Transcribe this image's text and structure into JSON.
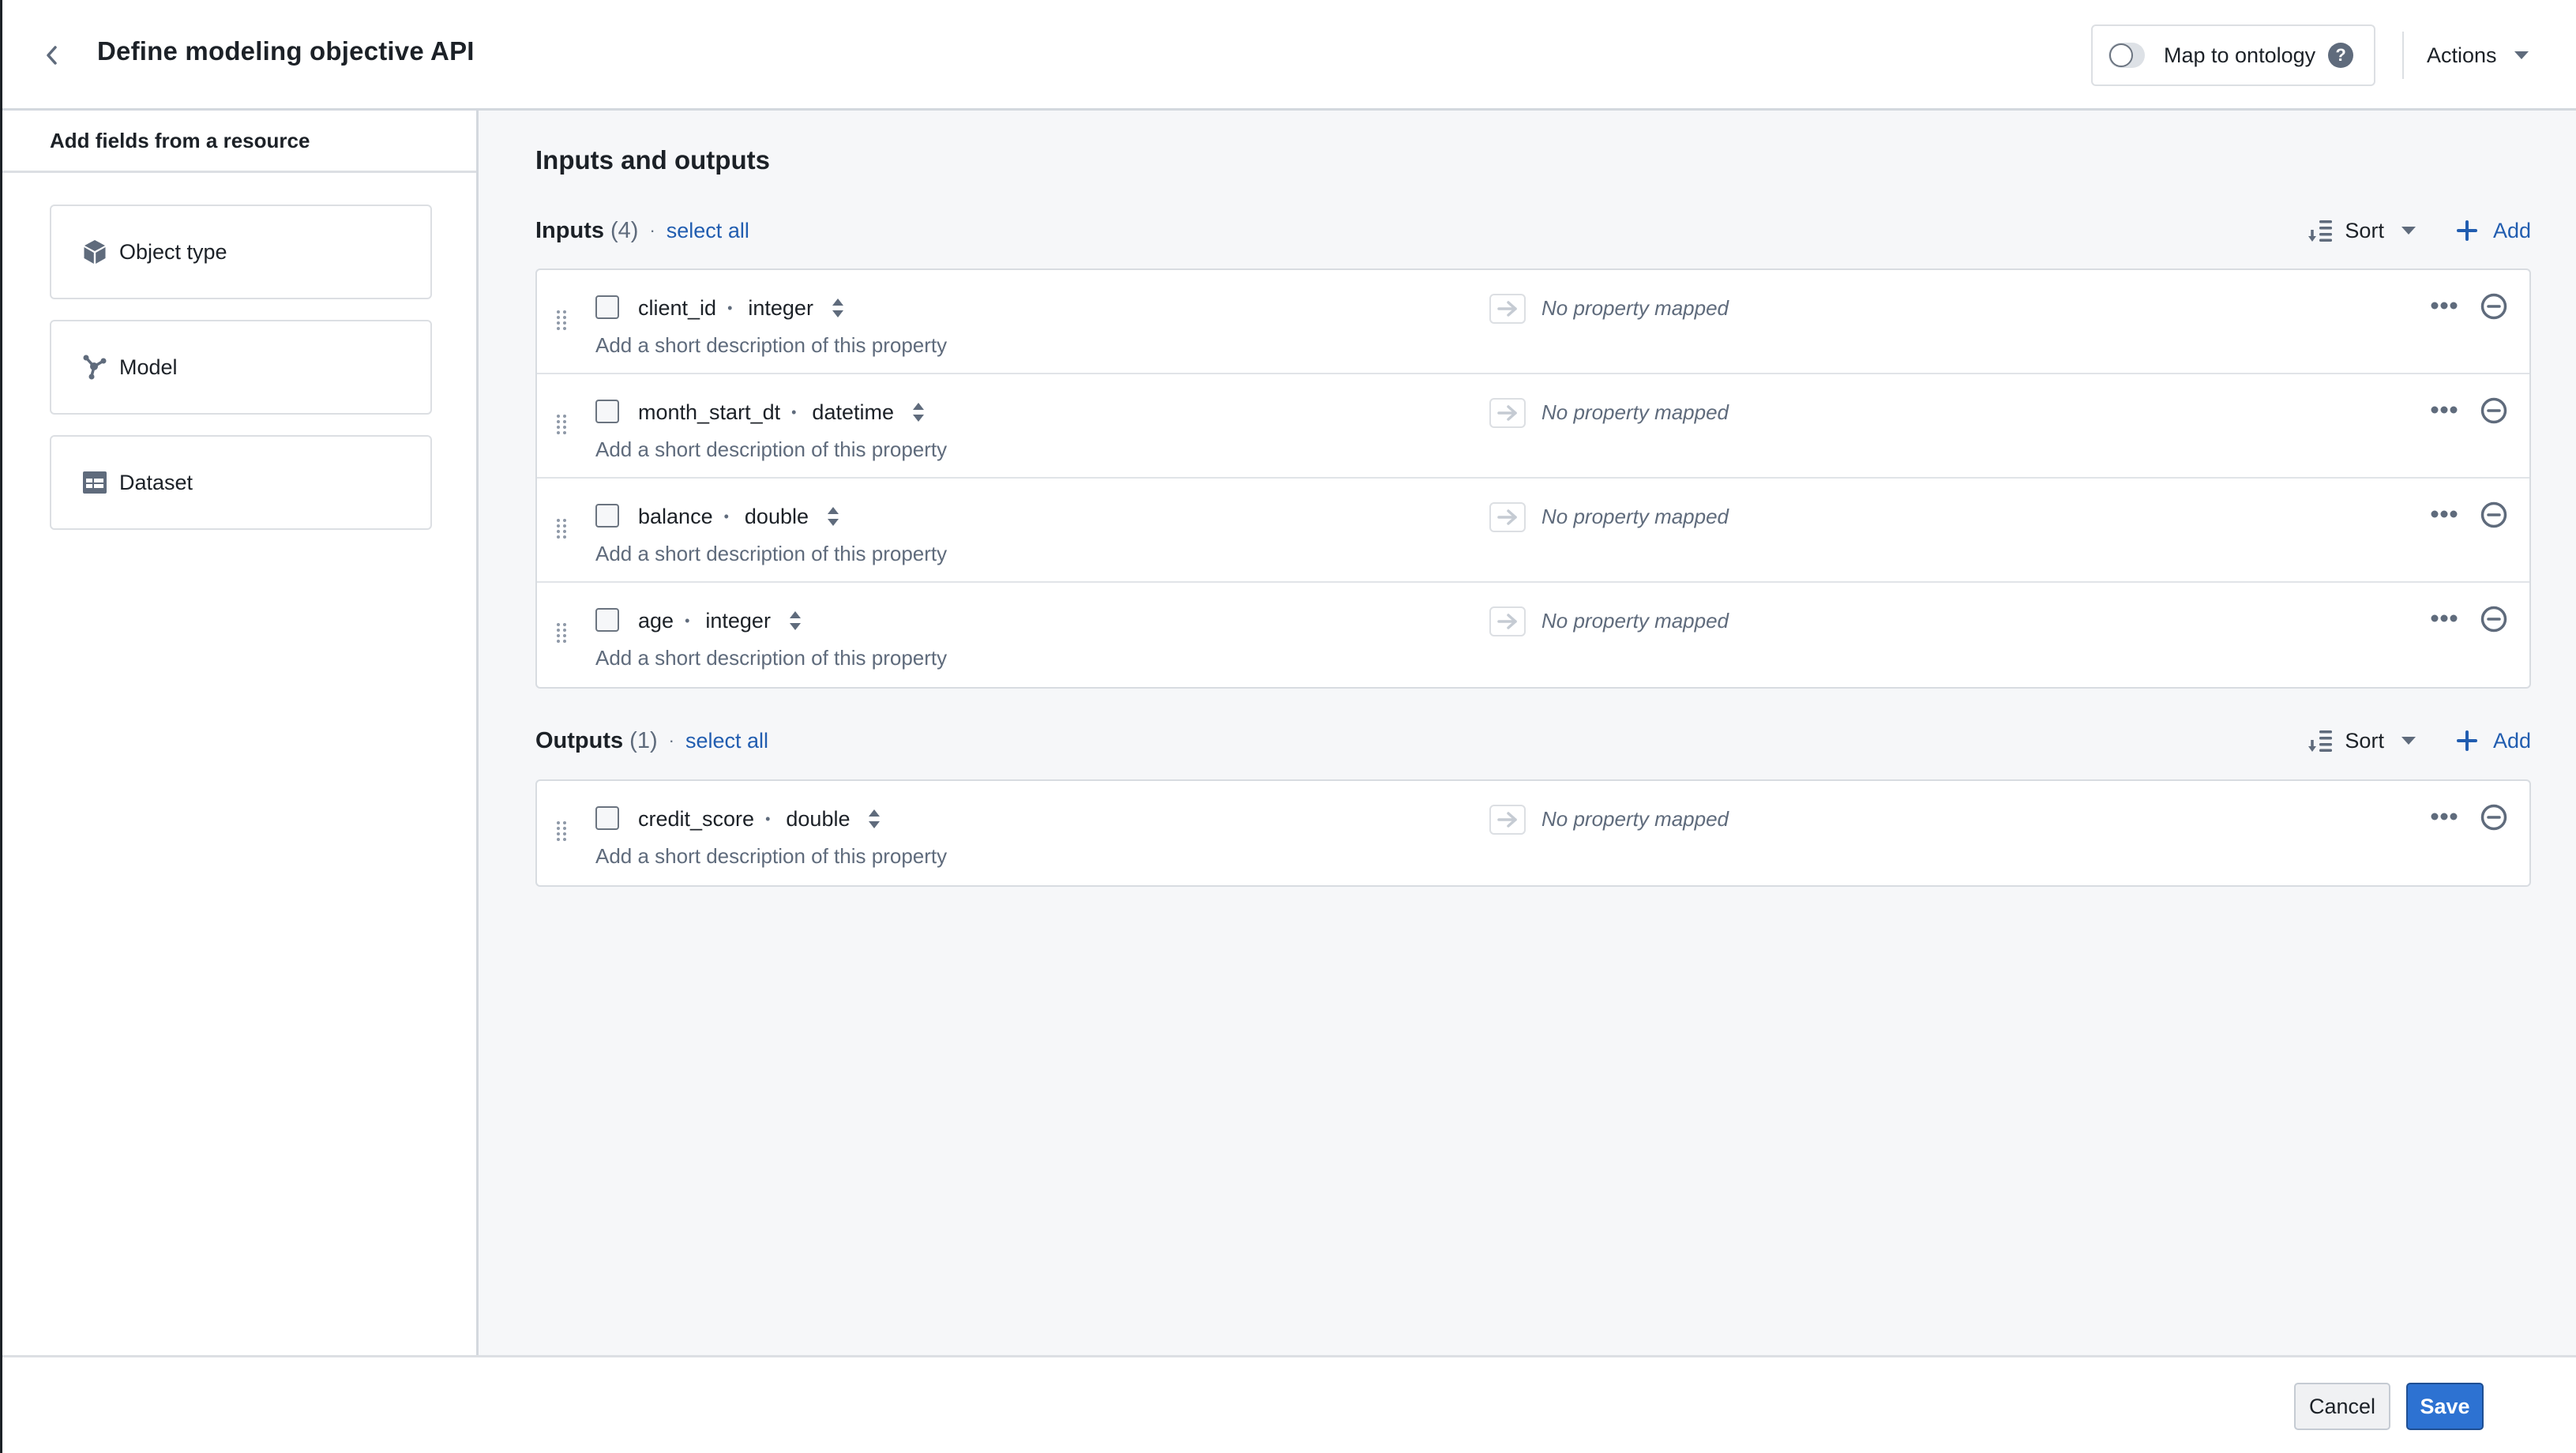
{
  "header": {
    "title": "Define modeling objective API",
    "back_icon": "chevron-left-icon",
    "map_to_ontology": {
      "label": "Map to ontology",
      "enabled": false,
      "help_icon": "question-icon"
    },
    "actions_label": "Actions"
  },
  "sidebar": {
    "heading": "Add fields from a resource",
    "resources": [
      {
        "label": "Object type",
        "icon": "cube-icon"
      },
      {
        "label": "Model",
        "icon": "model-icon"
      },
      {
        "label": "Dataset",
        "icon": "table-icon"
      }
    ]
  },
  "main": {
    "title": "Inputs and outputs",
    "inputs": {
      "title": "Inputs",
      "count": "(4)",
      "separator": "·",
      "select_all": "select all",
      "sort_label": "Sort",
      "add_label": "Add",
      "rows": [
        {
          "name": "client_id",
          "type": "integer",
          "description_placeholder": "Add a short description of this property",
          "mapping": "No property mapped"
        },
        {
          "name": "month_start_dt",
          "type": "datetime",
          "description_placeholder": "Add a short description of this property",
          "mapping": "No property mapped"
        },
        {
          "name": "balance",
          "type": "double",
          "description_placeholder": "Add a short description of this property",
          "mapping": "No property mapped"
        },
        {
          "name": "age",
          "type": "integer",
          "description_placeholder": "Add a short description of this property",
          "mapping": "No property mapped"
        }
      ]
    },
    "outputs": {
      "title": "Outputs",
      "count": "(1)",
      "separator": "·",
      "select_all": "select all",
      "sort_label": "Sort",
      "add_label": "Add",
      "rows": [
        {
          "name": "credit_score",
          "type": "double",
          "description_placeholder": "Add a short description of this property",
          "mapping": "No property mapped"
        }
      ]
    }
  },
  "footer": {
    "cancel_label": "Cancel",
    "save_label": "Save"
  },
  "colors": {
    "primary": "#2d72d2",
    "link": "#215db0",
    "muted": "#5f6b7c",
    "background": "#f6f7f9"
  }
}
